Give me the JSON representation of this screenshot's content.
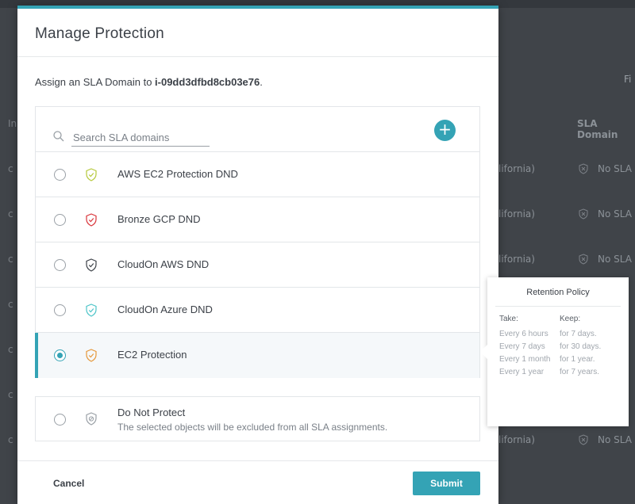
{
  "background": {
    "filter_label": "Fi",
    "col_left_label": "In",
    "sla_col_header": "SLA Domain",
    "rows": [
      {
        "left": "c",
        "region": "lifornia)",
        "sla": "No SLA"
      },
      {
        "left": "c",
        "region": "lifornia)",
        "sla": "No SLA"
      },
      {
        "left": "c",
        "region": "lifornia)",
        "sla": "No SLA"
      },
      {
        "left": "c",
        "region": "",
        "sla": ""
      },
      {
        "left": "c",
        "region": "",
        "sla": ""
      },
      {
        "left": "c",
        "region": "",
        "sla": ""
      },
      {
        "left": "c",
        "region": "lifornia)",
        "sla": "No SLA"
      }
    ]
  },
  "modal": {
    "title": "Manage Protection",
    "assign_prefix": "Assign an SLA Domain to ",
    "object_id": "i-09dd3dfbd8cb03e76",
    "assign_suffix": ".",
    "search_placeholder": "Search SLA domains",
    "add_icon": "plus-icon",
    "sla_domains": [
      {
        "label": "AWS EC2 Protection DND",
        "color": "#b5c83a",
        "selected": false
      },
      {
        "label": "Bronze GCP DND",
        "color": "#d9343a",
        "selected": false
      },
      {
        "label": "CloudOn AWS DND",
        "color": "#3c4148",
        "selected": false
      },
      {
        "label": "CloudOn Azure DND",
        "color": "#4cc4c8",
        "selected": false
      },
      {
        "label": "EC2 Protection",
        "color": "#e5973a",
        "selected": true
      }
    ],
    "do_not_protect": {
      "title": "Do Not Protect",
      "subtitle": "The selected objects will be excluded from all SLA assignments."
    },
    "cancel_label": "Cancel",
    "submit_label": "Submit",
    "accent_color": "#34a3b5"
  },
  "retention_policy": {
    "title": "Retention Policy",
    "take_header": "Take:",
    "keep_header": "Keep:",
    "take": [
      "Every 6 hours",
      "Every 7 days",
      "Every 1 month",
      "Every 1 year"
    ],
    "keep": [
      "for 7 days.",
      "for 30 days.",
      "for 1 year.",
      "for 7 years."
    ]
  }
}
